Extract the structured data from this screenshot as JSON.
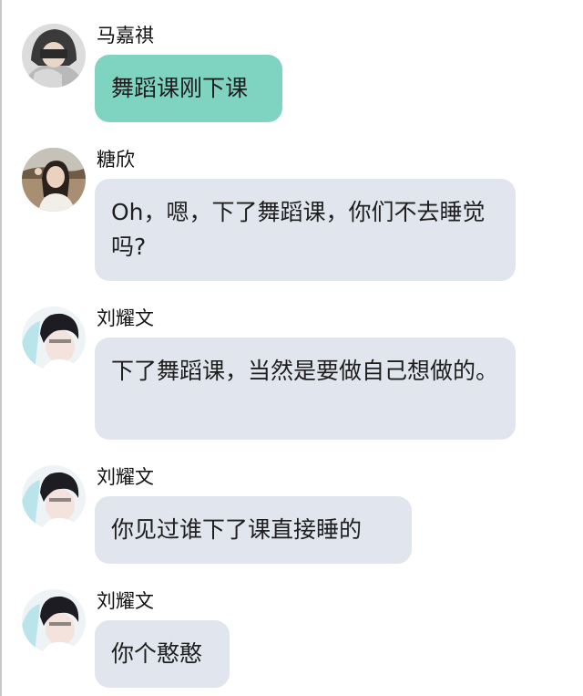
{
  "colors": {
    "mint_bubble": "#7fd4c1",
    "gray_bubble": "#e1e5ed",
    "name_text": "#111111",
    "message_text": "#1e1e1e"
  },
  "messages": [
    {
      "sender": "马嘉祺",
      "text": "舞蹈课刚下课",
      "bubble_color": "mint",
      "avatar": "hooded-boy-avatar"
    },
    {
      "sender": "糖欣",
      "text": "Oh，嗯，下了舞蹈课，你们不去睡觉吗?",
      "bubble_color": "gray",
      "avatar": "girl-outdoor-avatar"
    },
    {
      "sender": "刘耀文",
      "text": "下了舞蹈课，当然是要做自己想做的。",
      "bubble_color": "gray",
      "avatar": "boy-avatar"
    },
    {
      "sender": "刘耀文",
      "text": "你见过谁下了课直接睡的",
      "bubble_color": "gray",
      "avatar": "boy-avatar"
    },
    {
      "sender": "刘耀文",
      "text": "你个憨憨",
      "bubble_color": "gray",
      "avatar": "boy-avatar"
    }
  ]
}
